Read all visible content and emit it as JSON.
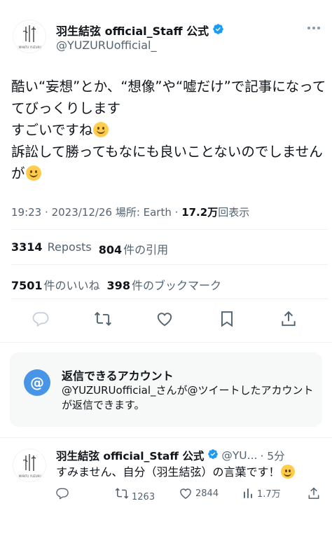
{
  "main_tweet": {
    "author": {
      "name": "羽生結弦 official_Staff 公式",
      "handle": "@YUZURUofficial_",
      "avatar_logo_text": "MANTU YUZURU"
    },
    "text_lines": [
      "酷い“妄想”とか、“想像”や“嘘だけ”で記事になって",
      "てびっくりします",
      "すごいですね",
      "訴訟して勝ってもなにも良いことないのでしませんが"
    ],
    "text_line4_wrap": "が",
    "emoji": "smiling-face-icon",
    "time": "19:23",
    "date": "2023/12/26",
    "location_label": "場所: Earth",
    "views_count": "17.2万",
    "views_label": "回表示",
    "reposts_count": "3314",
    "reposts_label": "Reposts",
    "quotes_count": "804",
    "quotes_label": "件の引用",
    "likes_count": "7501",
    "likes_label": "件のいいね",
    "bookmarks_count": "398",
    "bookmarks_label": "件のブックマーク"
  },
  "reply_restriction": {
    "title": "返信できるアカウント",
    "description": "@YUZURUofficial_さんが@ツイートしたアカウントが返信できます。",
    "icon": "at-sign-icon"
  },
  "reply_tweet": {
    "name": "羽生結弦 official_Staff 公式",
    "handle_truncated": "@YU...",
    "time_ago": "· 5分",
    "text": "すみません、自分（羽生結弦）の言葉です！",
    "repost_count": "1263",
    "like_count": "2844",
    "view_count": "1.7万"
  },
  "colors": {
    "text": "#0f1419",
    "secondary": "#536471",
    "verified": "#1d9bf0",
    "at_circle": "#4895e7",
    "card_bg": "#f7f9f9"
  }
}
